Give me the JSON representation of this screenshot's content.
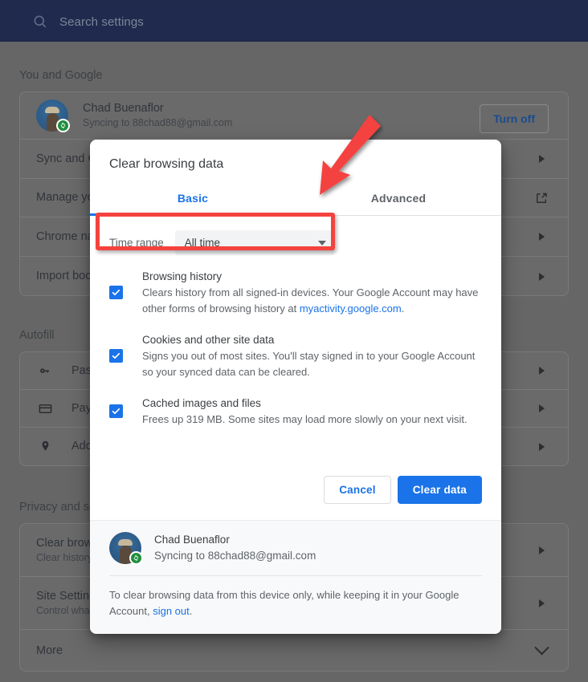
{
  "search": {
    "placeholder": "Search settings",
    "icon": "search-icon"
  },
  "background": {
    "sections": [
      {
        "title": "You and Google"
      },
      {
        "title": "Autofill"
      },
      {
        "title": "Privacy and security"
      }
    ],
    "profile": {
      "name": "Chad Buenaflor",
      "sync_status": "Syncing to 88chad88@gmail.com",
      "turn_off_label": "Turn off",
      "avatar_icon": "avatar",
      "sync_badge_icon": "sync-icon"
    },
    "you_and_google_rows": [
      {
        "title": "Sync and Google services",
        "end_icon": "chevron-right-icon"
      },
      {
        "title": "Manage your Google Account",
        "end_icon": "external-link-icon"
      },
      {
        "title": "Chrome name and picture",
        "end_icon": "chevron-right-icon"
      },
      {
        "title": "Import bookmarks and settings",
        "end_icon": "chevron-right-icon"
      }
    ],
    "autofill_rows": [
      {
        "title": "Passwords",
        "icon": "key-icon",
        "end_icon": "chevron-right-icon"
      },
      {
        "title": "Payment methods",
        "icon": "credit-card-icon",
        "end_icon": "chevron-right-icon"
      },
      {
        "title": "Addresses and more",
        "icon": "location-pin-icon",
        "end_icon": "chevron-right-icon"
      }
    ],
    "privacy_rows": [
      {
        "title": "Clear browsing data",
        "sub": "Clear history, cookies, cache, and more",
        "end_icon": "chevron-right-icon"
      },
      {
        "title": "Site Settings",
        "sub": "Control what information websites can use",
        "end_icon": "chevron-right-icon"
      },
      {
        "title": "More",
        "sub": "",
        "end_icon": "chevron-down-icon"
      }
    ]
  },
  "dialog": {
    "title": "Clear browsing data",
    "tabs": [
      {
        "label": "Basic",
        "active": true
      },
      {
        "label": "Advanced",
        "active": false
      }
    ],
    "time_range": {
      "label": "Time range",
      "value": "All time",
      "caret_icon": "chevron-down-icon"
    },
    "items": [
      {
        "checked": true,
        "title": "Browsing history",
        "desc_before": "Clears history from all signed-in devices. Your Google Account may have other forms of browsing history at ",
        "link": "myactivity.google.com",
        "desc_after": "."
      },
      {
        "checked": true,
        "title": "Cookies and other site data",
        "desc_before": "Signs you out of most sites. You'll stay signed in to your Google Account so your synced data can be cleared.",
        "link": "",
        "desc_after": ""
      },
      {
        "checked": true,
        "title": "Cached images and files",
        "desc_before": "Frees up 319 MB. Some sites may load more slowly on your next visit.",
        "link": "",
        "desc_after": ""
      }
    ],
    "buttons": {
      "cancel": "Cancel",
      "confirm": "Clear data"
    },
    "footer": {
      "account_name": "Chad Buenaflor",
      "account_sync": "Syncing to 88chad88@gmail.com",
      "note_before": "To clear browsing data from this device only, while keeping it in your Google Account, ",
      "note_link": "sign out",
      "note_after": "."
    }
  },
  "annotations": {
    "highlight_target": "time-range-row",
    "arrow_target": "time-range-row",
    "color": "#f4433f"
  },
  "colors": {
    "accent": "#1a73e8",
    "topbar": "#202a4d",
    "scrim": "#666666",
    "annotation": "#f4433f",
    "sync_badge": "#1e8e3e"
  }
}
